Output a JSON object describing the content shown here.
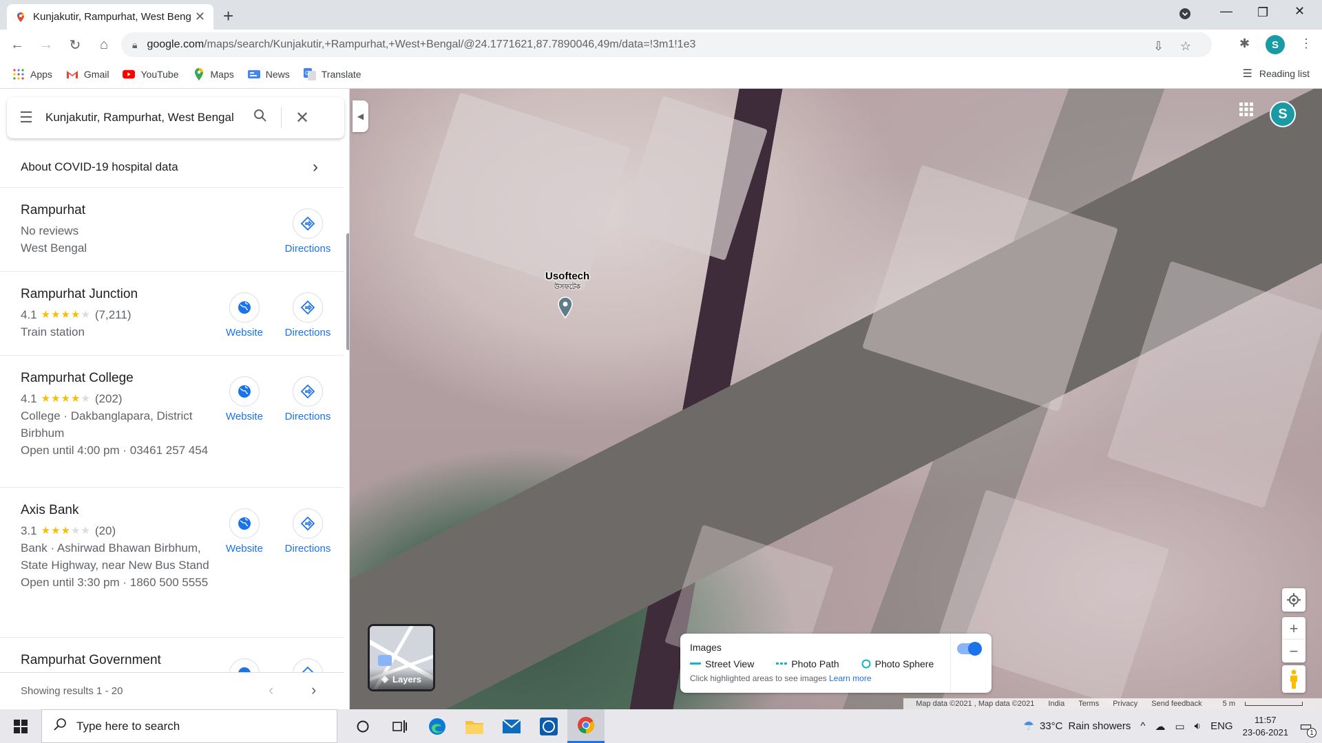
{
  "browser": {
    "tab_title": "Kunjakutir, Rampurhat, West Bengal",
    "url_host": "google.com",
    "url_path": "/maps/search/Kunjakutir,+Rampurhat,+West+Bengal/@24.1771621,87.7890046,49m/data=!3m1!1e3",
    "profile_initial": "S",
    "bookmarks": [
      {
        "label": "Apps",
        "icon": "apps-grid-icon"
      },
      {
        "label": "Gmail",
        "icon": "gmail-icon"
      },
      {
        "label": "YouTube",
        "icon": "youtube-icon"
      },
      {
        "label": "Maps",
        "icon": "maps-icon"
      },
      {
        "label": "News",
        "icon": "news-icon"
      },
      {
        "label": "Translate",
        "icon": "translate-icon"
      }
    ],
    "reading_list": "Reading list"
  },
  "sidebar": {
    "search_value": "Kunjakutir, Rampurhat, West Bengal",
    "covid_link": "About COVID-19 hospital data",
    "results": [
      {
        "name": "Rampurhat",
        "lines": [
          "No reviews",
          "West Bengal"
        ],
        "rating": null,
        "reviews": null,
        "website": false,
        "directions": "Directions"
      },
      {
        "name": "Rampurhat Junction",
        "rating": "4.1",
        "stars": 4,
        "reviews": "(7,211)",
        "lines": [
          "Train station"
        ],
        "website": "Website",
        "directions": "Directions"
      },
      {
        "name": "Rampurhat College",
        "rating": "4.1",
        "stars": 4,
        "reviews": "(202)",
        "lines": [
          "College · Dakbanglapara, District Birbhum",
          "Open until 4:00 pm · 03461 257 454"
        ],
        "website": "Website",
        "directions": "Directions"
      },
      {
        "name": "Axis Bank",
        "rating": "3.1",
        "stars": 3,
        "reviews": "(20)",
        "lines": [
          "Bank · Ashirwad Bhawan Birbhum, State Highway, near New Bus Stand",
          "Open until 3:30 pm · 1860 500 5555"
        ],
        "website": "Website",
        "directions": "Directions"
      },
      {
        "name": "Rampurhat Government",
        "rating": null,
        "reviews": null,
        "lines": [],
        "website": "Website",
        "directions": "Directions"
      }
    ],
    "showing": "Showing results 1 - 20"
  },
  "map": {
    "pin_label": "Usoftech",
    "pin_sublabel": "উসফটেক",
    "layers_label": "Layers",
    "images_panel": {
      "title": "Images",
      "street_view": "Street View",
      "photo_path": "Photo Path",
      "photo_sphere": "Photo Sphere",
      "hint": "Click highlighted areas to see images",
      "learn_more": "Learn more",
      "toggle_on": true
    },
    "attribution": {
      "data": "Map data ©2021 , Map data ©2021",
      "country": "India",
      "terms": "Terms",
      "privacy": "Privacy",
      "feedback": "Send feedback",
      "scale": "5 m"
    },
    "profile_initial": "S"
  },
  "taskbar": {
    "search_placeholder": "Type here to search",
    "weather_temp": "33°C",
    "weather_desc": "Rain showers",
    "language": "ENG",
    "time": "11:57",
    "date": "23-06-2021",
    "notification_count": "1"
  },
  "colors": {
    "accent": "#1a73e8",
    "star": "#fbbc04",
    "avatar": "#1a9aa5"
  }
}
